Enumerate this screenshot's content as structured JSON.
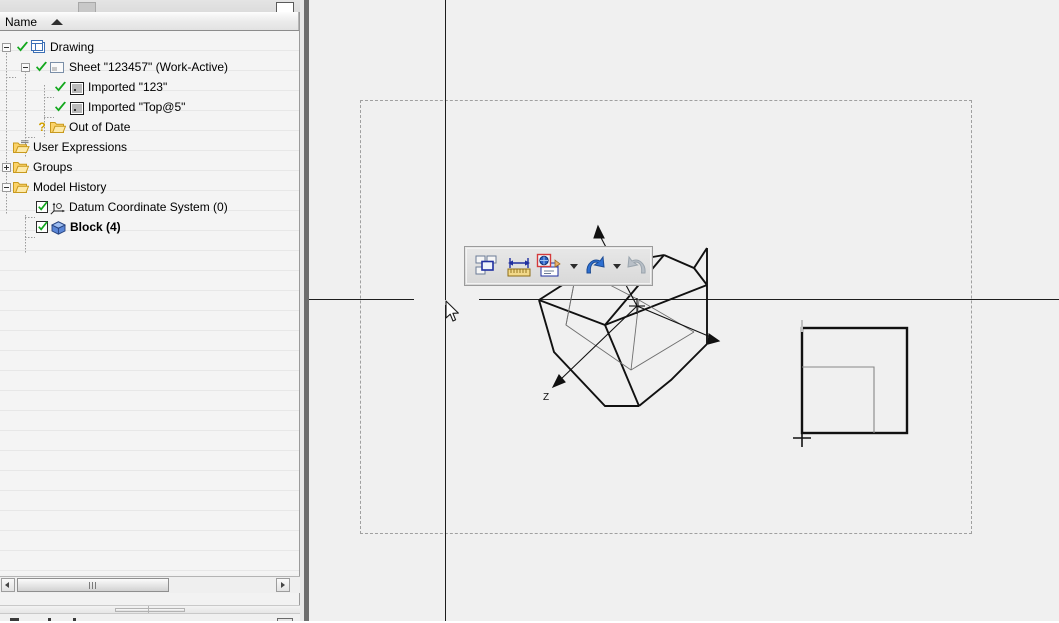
{
  "window": {
    "title_cut": true
  },
  "navigator": {
    "header": {
      "column_label": "Name",
      "sort_icon": "sort-ascending-arrow"
    },
    "items": [
      {
        "label": "Drawing",
        "depth": 0,
        "icon": "drawing-icon",
        "mark": "green-check",
        "expander": "minus",
        "bold": false
      },
      {
        "label": "Sheet \"123457\" (Work-Active)",
        "depth": 1,
        "icon": "sheet-icon",
        "mark": "green-check",
        "expander": "minus",
        "bold": false
      },
      {
        "label": "Imported \"123\"",
        "depth": 2,
        "icon": "imported-icon",
        "mark": "green-check",
        "expander": "none",
        "bold": false
      },
      {
        "label": "Imported \"Top@5\"",
        "depth": 2,
        "icon": "imported-icon",
        "mark": "green-check",
        "expander": "none",
        "bold": false
      },
      {
        "label": "Out of Date",
        "depth": 1,
        "icon": "folder-icon",
        "mark": "question-mark",
        "expander": "none",
        "bold": false
      },
      {
        "label": "User Expressions",
        "depth": 0,
        "icon": "expressions-folder-icon",
        "mark": "none",
        "expander": "none",
        "bold": false
      },
      {
        "label": "Groups",
        "depth": 0,
        "icon": "folder-icon",
        "mark": "none",
        "expander": "plus",
        "bold": false
      },
      {
        "label": "Model History",
        "depth": 0,
        "icon": "folder-icon",
        "mark": "none",
        "expander": "minus",
        "bold": false
      },
      {
        "label": "Datum Coordinate System (0)",
        "depth": 1,
        "icon": "datum-csys-icon",
        "mark": "checkbox",
        "expander": "none",
        "bold": false
      },
      {
        "label": "Block (4)",
        "depth": 1,
        "icon": "block-cube-icon",
        "mark": "checkbox",
        "expander": "none",
        "bold": true
      }
    ],
    "hscrollbar": {
      "left_arrow": "scroll-left-arrow",
      "right_arrow": "scroll-right-arrow",
      "thumb": "horizontal-scroll-thumb"
    }
  },
  "mini_toolbar": {
    "buttons": [
      {
        "name": "arrange-views-button",
        "icon": "arrange-windows-icon",
        "enabled": true,
        "has_caret": false
      },
      {
        "name": "dimension-button",
        "icon": "measure-ruler-icon",
        "enabled": true,
        "has_caret": false
      },
      {
        "name": "update-views-button",
        "icon": "update-view-icon",
        "enabled": true,
        "has_caret": true
      },
      {
        "name": "undo-button",
        "icon": "undo-arrow-icon",
        "enabled": true,
        "has_caret": true
      },
      {
        "name": "redo-button",
        "icon": "redo-arrow-icon",
        "enabled": false,
        "has_caret": false
      }
    ]
  },
  "viewport": {
    "sheet_border": "dashed-sheet-boundary",
    "centerline_vertical": "vertical-centerline",
    "centerline_horizontal": "horizontal-centerline",
    "cursor": "mouse-arrow-cursor",
    "triad": {
      "axes": [
        {
          "label": "",
          "name": "y-axis-arrow"
        },
        {
          "label": "",
          "name": "x-axis-arrow"
        },
        {
          "label": "Z",
          "name": "z-axis-arrow"
        }
      ],
      "origin_marker": "origin-crosshair"
    },
    "solid": "wireframe-block",
    "flat_view": "square-profile-view"
  },
  "colors": {
    "panel_bg": "#f2f2f2",
    "viewport_bg": "#f0f0f0",
    "sheet_border": "#a0a0a0",
    "geometry": "#111111",
    "check_green": "#14a81e",
    "folder_yellow": "#f0c23a",
    "undo_blue": "#1f66c4",
    "redo_gray": "#9aa4ad",
    "accent_blue": "#2b3fa8"
  }
}
